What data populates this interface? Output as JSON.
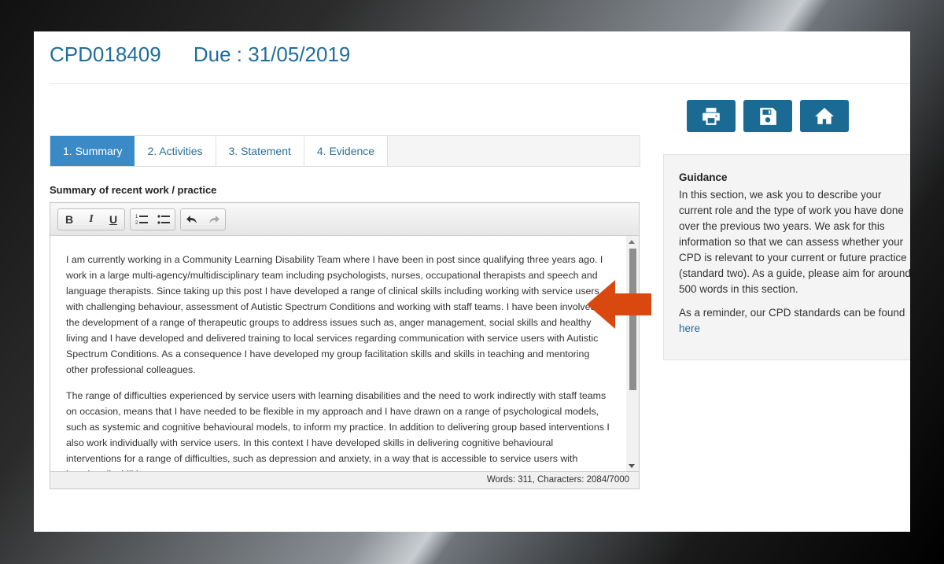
{
  "header": {
    "ref": "CPD018409",
    "due": "Due : 31/05/2019"
  },
  "actions": [
    {
      "icon": "print-icon"
    },
    {
      "icon": "save-icon"
    },
    {
      "icon": "home-icon"
    }
  ],
  "tabs": [
    {
      "label": "1. Summary",
      "active": true
    },
    {
      "label": "2. Activities",
      "active": false
    },
    {
      "label": "3. Statement",
      "active": false
    },
    {
      "label": "4. Evidence",
      "active": false
    }
  ],
  "editor": {
    "label": "Summary of recent work / practice",
    "toolbar": {
      "bold": "B",
      "italic": "I",
      "underline": "U"
    },
    "paragraphs": [
      "I am currently working in a Community Learning Disability Team where I have been in post since qualifying three years ago. I work in a large multi-agency/multidisciplinary team including psychologists, nurses, occupational therapists and speech and language therapists. Since taking up this post I have developed a range of clinical skills including working with service users with challenging behaviour, assessment of Autistic Spectrum Conditions and working with staff teams. I have been involved in the development of a range of therapeutic groups to address issues such as, anger management, social skills and healthy living and I have developed and delivered training to local services regarding communication with service users with Autistic Spectrum Conditions. As a consequence I have developed my group facilitation skills and skills in teaching and mentoring other professional colleagues.",
      "The range of difficulties experienced by service users with learning disabilities and the need to work indirectly with staff teams on occasion, means that I have needed to be flexible in my approach and I have drawn on a range of psychological models, such as systemic and cognitive behavioural models, to inform my practice. In addition to delivering group based interventions I also work individually with service users. In this context I have developed skills in delivering cognitive behavioural interventions for a range of difficulties, such as depression and anxiety, in a way that is accessible to service users with learning disabilities."
    ],
    "status": "Words: 311, Characters: 2084/7000"
  },
  "guidance": {
    "title": "Guidance",
    "para1": "In this section, we ask you to describe your current role and the type of work you have done over the previous two years. We ask for this information so that we can assess whether your CPD is relevant to your current or future practice (standard two). As a guide, please aim for around 500 words in this section.",
    "para2": "As a reminder, our CPD standards can be found",
    "link": "here"
  },
  "colors": {
    "accent": "#1a6a93",
    "tab_active": "#3a8ac7",
    "arrow": "#d9480f"
  }
}
